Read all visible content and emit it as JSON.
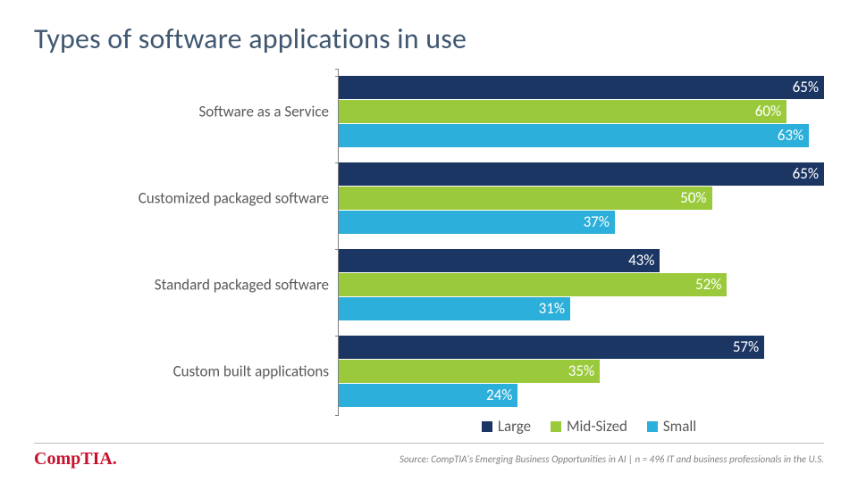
{
  "title": "Types of software applications in use",
  "legend": {
    "large": "Large",
    "mid": "Mid-Sized",
    "small": "Small"
  },
  "colors": {
    "large": "#1c3663",
    "mid": "#9aca3c",
    "small": "#2cafda"
  },
  "footer": {
    "source_prefix": "Source: CompTIA's ",
    "source_title": "Emerging Business Opportunities in AI",
    "source_suffix": " | n = 496 IT and business professionals in the U.S.",
    "logo": "CompTIA"
  },
  "chart_data": {
    "type": "bar",
    "orientation": "horizontal",
    "categories": [
      "Software as a Service",
      "Customized packaged software",
      "Standard packaged software",
      "Custom built applications"
    ],
    "series": [
      {
        "name": "Large",
        "values": [
          65,
          65,
          43,
          57
        ]
      },
      {
        "name": "Mid-Sized",
        "values": [
          60,
          50,
          52,
          35
        ]
      },
      {
        "name": "Small",
        "values": [
          63,
          37,
          31,
          24
        ]
      }
    ],
    "xlim": [
      0,
      65
    ],
    "value_suffix": "%",
    "title": "Types of software applications in use"
  },
  "labels": {
    "cat0": "Software as a Service",
    "cat1": "Customized packaged software",
    "cat2": "Standard packaged software",
    "cat3": "Custom built applications",
    "v0l": "65%",
    "v0m": "60%",
    "v0s": "63%",
    "v1l": "65%",
    "v1m": "50%",
    "v1s": "37%",
    "v2l": "43%",
    "v2m": "52%",
    "v2s": "31%",
    "v3l": "57%",
    "v3m": "35%",
    "v3s": "24%"
  }
}
